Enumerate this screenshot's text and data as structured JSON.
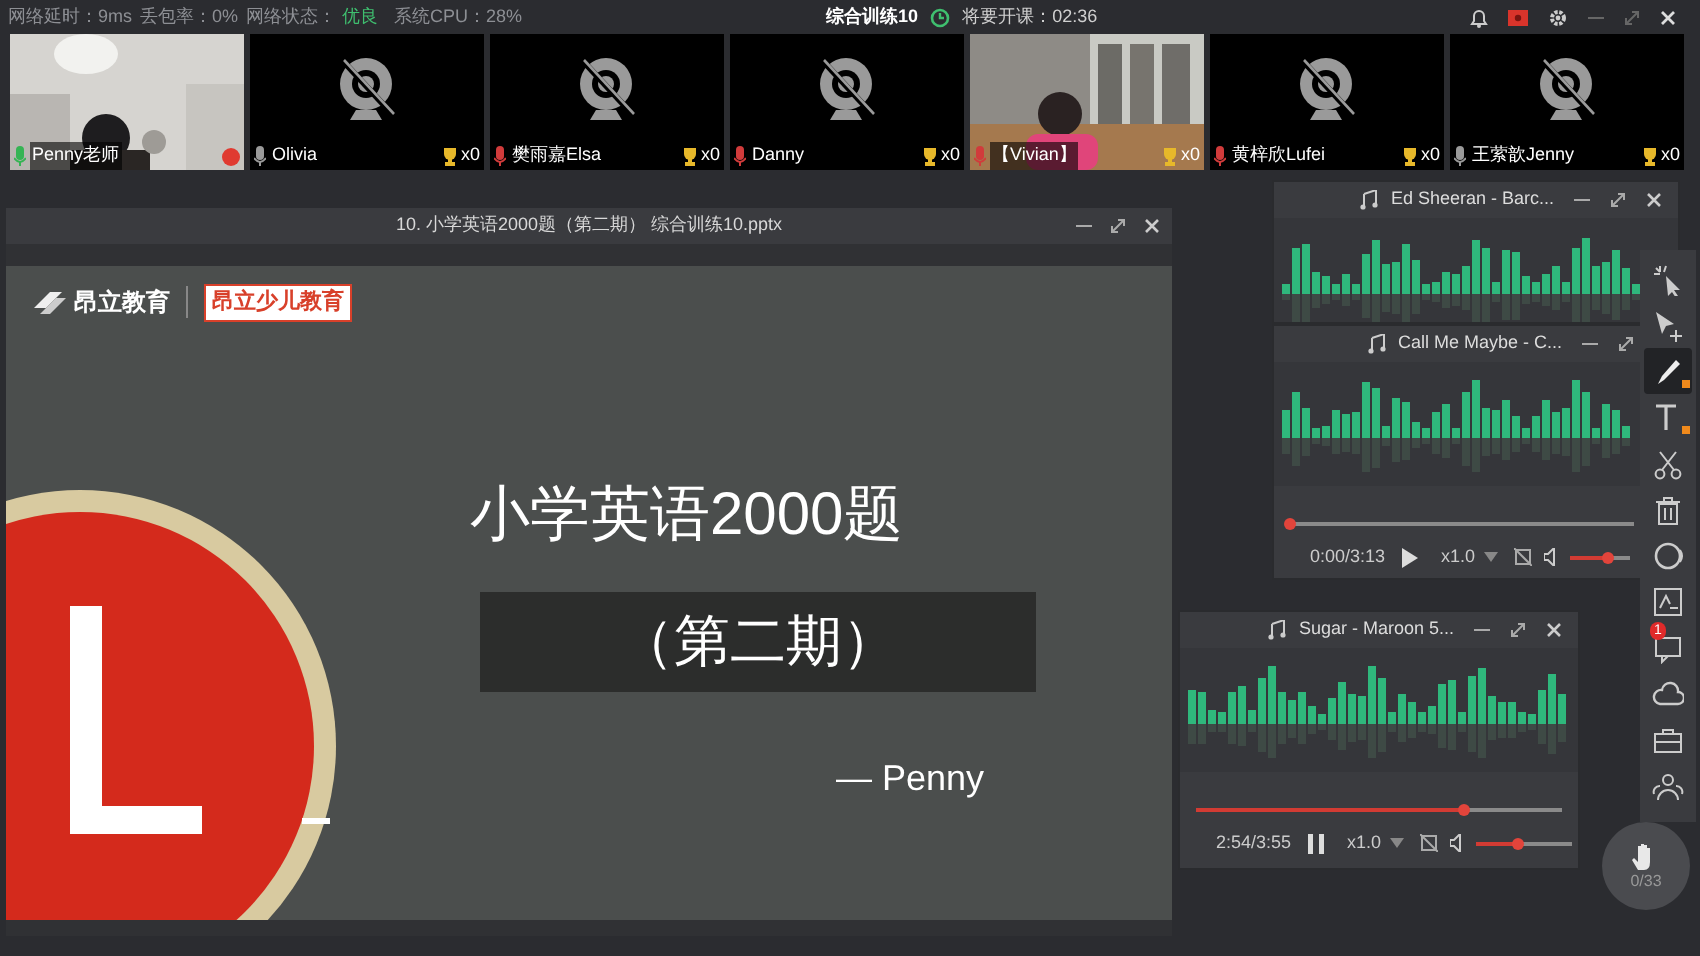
{
  "top_bar": {
    "latency": "网络延时：9ms",
    "loss": "丢包率：0%",
    "network_label": "网络状态：",
    "network_value": "优良",
    "cpu": "系统CPU：28%",
    "class_title": "综合训练10",
    "countdown": "将要开课：02:36"
  },
  "videos": [
    {
      "name": "Penny老师",
      "kind": "teacher",
      "camera_on": true,
      "color": "#35b454"
    },
    {
      "name": "Olivia",
      "kind": "student",
      "camera_on": false,
      "color": "#9a9a9a",
      "trophies": "x0"
    },
    {
      "name": "樊雨嘉Elsa",
      "kind": "student",
      "camera_on": false,
      "color": "#d13b3b",
      "trophies": "x0"
    },
    {
      "name": "Danny",
      "kind": "student",
      "camera_on": false,
      "color": "#d13b3b",
      "trophies": "x0"
    },
    {
      "name": "【Vivian】",
      "kind": "student",
      "camera_on": true,
      "color": "#d13b3b",
      "trophies": "x0"
    },
    {
      "name": "黄梓欣Lufei",
      "kind": "student",
      "camera_on": false,
      "color": "#d13b3b",
      "trophies": "x0"
    },
    {
      "name": "王萦歆Jenny",
      "kind": "student",
      "camera_on": false,
      "color": "#9a9a9a",
      "trophies": "x0"
    }
  ],
  "presentation": {
    "title": "10. 小学英语2000题（第二期） 综合训练10.pptx",
    "logo_text": "昂立教育",
    "brand_badge": "昂立少儿教育",
    "slide_title": "小学英语2000题",
    "slide_subtitle": "（第二期）",
    "slide_author": "— Penny"
  },
  "players": [
    {
      "title": "Ed Sheeran - Barc...",
      "close_visible": true,
      "controls": false
    },
    {
      "title": "Call Me Maybe - C...",
      "close_visible": false,
      "controls": true,
      "progress": {
        "level": 0
      },
      "time": "0:00/3:13",
      "playing": false,
      "speed": "x1.0",
      "volume": {
        "level": 0.65
      }
    },
    {
      "title": "Sugar - Maroon 5...",
      "close_visible": true,
      "controls": true,
      "progress": {
        "level": 0.73
      },
      "time": "2:54/3:55",
      "playing": true,
      "speed": "x1.0",
      "volume": {
        "level": 0.45
      }
    }
  ],
  "toolbar": [
    {
      "kind": "laser",
      "selected": false,
      "options": false
    },
    {
      "kind": "select",
      "selected": false,
      "options": false
    },
    {
      "kind": "pen",
      "selected": true,
      "options": true
    },
    {
      "kind": "text",
      "selected": false,
      "options": true
    },
    {
      "kind": "scissors",
      "selected": false,
      "options": false
    },
    {
      "kind": "trash",
      "selected": false,
      "options": false
    },
    {
      "kind": "shape",
      "selected": false,
      "options": false
    },
    {
      "kind": "formula",
      "selected": false,
      "options": false
    },
    {
      "kind": "chat",
      "selected": false,
      "options": false,
      "badge": "1"
    },
    {
      "kind": "cloud",
      "selected": false,
      "options": false
    },
    {
      "kind": "toolbox",
      "selected": false,
      "options": false
    },
    {
      "kind": "group",
      "selected": false,
      "options": false
    }
  ],
  "hand_raise": {
    "count": "0/33"
  }
}
